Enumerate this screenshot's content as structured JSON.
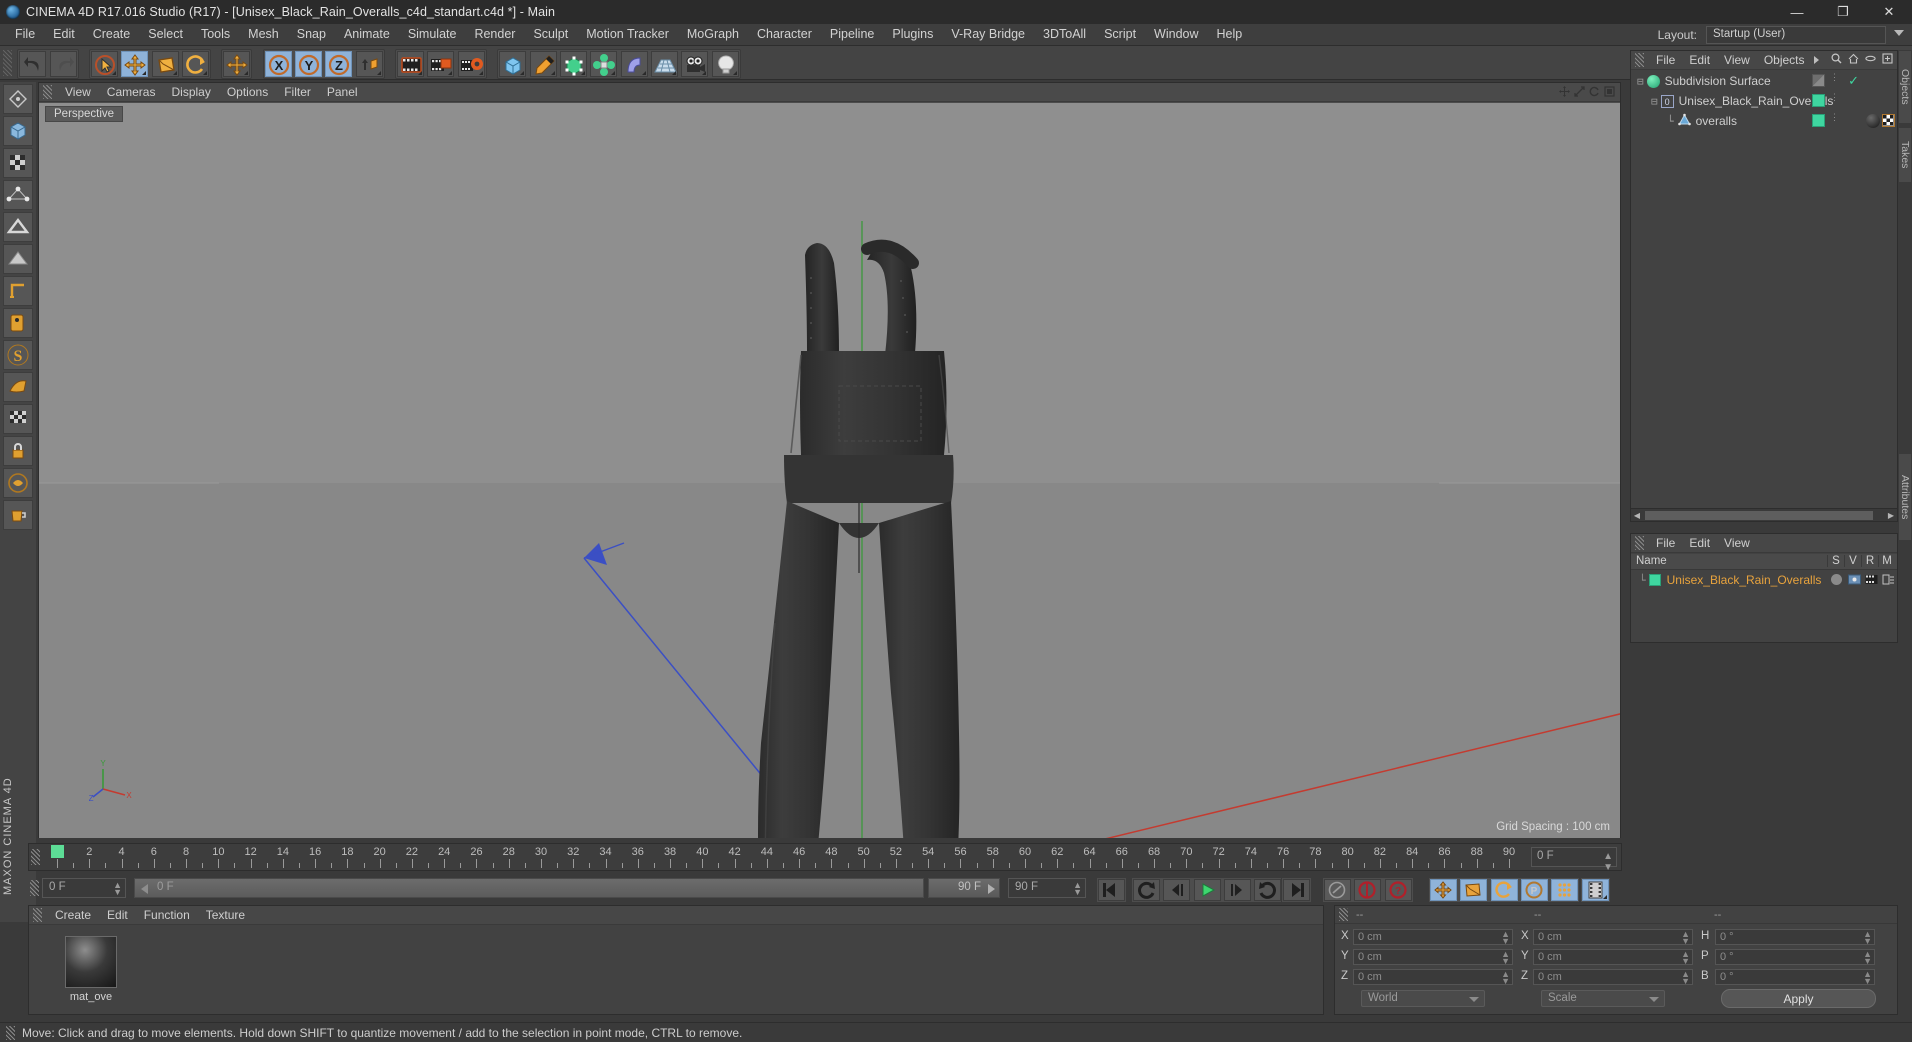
{
  "window": {
    "title": "CINEMA 4D R17.016 Studio (R17) - [Unisex_Black_Rain_Overalls_c4d_standart.c4d *] - Main",
    "app_icon": "cinema4d-logo-icon",
    "minimize": "—",
    "maximize": "❐",
    "close": "✕"
  },
  "menubar": {
    "items": [
      "File",
      "Edit",
      "Create",
      "Select",
      "Tools",
      "Mesh",
      "Snap",
      "Animate",
      "Simulate",
      "Render",
      "Sculpt",
      "Motion Tracker",
      "MoGraph",
      "Character",
      "Pipeline",
      "Plugins",
      "V-Ray Bridge",
      "3DToAll",
      "Script",
      "Window",
      "Help"
    ],
    "layout_label": "Layout:",
    "layout_value": "Startup (User)"
  },
  "toolbar": {
    "groups": [
      {
        "name": "history",
        "buttons": [
          {
            "icon": "undo-icon",
            "label": "Undo",
            "active": false
          },
          {
            "icon": "redo-icon",
            "label": "Redo",
            "active": false,
            "disabled": true
          }
        ]
      },
      {
        "name": "transform",
        "buttons": [
          {
            "icon": "live-selection-icon",
            "label": "Live Selection",
            "active": false
          },
          {
            "icon": "move-icon",
            "label": "Move",
            "active": true
          },
          {
            "icon": "scale-icon",
            "label": "Scale",
            "active": false
          },
          {
            "icon": "rotate-icon",
            "label": "Rotate",
            "active": false
          }
        ]
      },
      {
        "name": "move-world",
        "buttons": [
          {
            "icon": "move-world-icon",
            "label": "Move",
            "active": false
          }
        ]
      },
      {
        "name": "axis-locks",
        "buttons": [
          {
            "icon": "lock-x-icon",
            "label": "X",
            "active": true
          },
          {
            "icon": "lock-y-icon",
            "label": "Y",
            "active": true
          },
          {
            "icon": "lock-z-icon",
            "label": "Z",
            "active": true
          },
          {
            "icon": "world-object-icon",
            "label": "World / Object",
            "active": false
          }
        ]
      },
      {
        "name": "render",
        "buttons": [
          {
            "icon": "render-view-icon",
            "label": "Render View",
            "active": false
          },
          {
            "icon": "render-region-icon",
            "label": "Render to Picture Viewer",
            "active": false
          },
          {
            "icon": "render-settings-icon",
            "label": "Edit Render Settings",
            "active": false
          }
        ]
      },
      {
        "name": "create",
        "buttons": [
          {
            "icon": "cube-primitive-icon",
            "label": "Add Cube Object",
            "active": false
          },
          {
            "icon": "spline-pen-icon",
            "label": "Create Spline",
            "active": false
          },
          {
            "icon": "nurbs-icon",
            "label": "Subdivision Surface",
            "active": false
          },
          {
            "icon": "array-icon",
            "label": "Array Object",
            "active": false
          },
          {
            "icon": "deformer-icon",
            "label": "Bend Object",
            "active": false
          },
          {
            "icon": "floor-icon",
            "label": "Floor Object",
            "active": false
          },
          {
            "icon": "camera-icon",
            "label": "Camera",
            "active": false
          },
          {
            "icon": "light-icon",
            "label": "Light",
            "active": false
          }
        ]
      }
    ]
  },
  "left_toolbar": {
    "buttons": [
      {
        "icon": "make-editable-icon",
        "label": "Make Editable"
      },
      {
        "icon": "model-mode-icon",
        "label": "Model Mode"
      },
      {
        "icon": "texture-mode-icon",
        "label": "Texture Mode"
      },
      {
        "icon": "points-mode-icon",
        "label": "Points Mode"
      },
      {
        "icon": "edges-mode-icon",
        "label": "Edges Mode"
      },
      {
        "icon": "polygons-mode-icon",
        "label": "Polygons Mode"
      },
      {
        "icon": "axis-mode-icon",
        "label": "Enable Axis Modification"
      },
      {
        "icon": "viewport-solo-icon",
        "label": "Viewport Solo Single"
      },
      {
        "icon": "enable-snap-icon",
        "label": "Enable Snapping"
      },
      {
        "icon": "workplane-icon",
        "label": "Lock Workplane"
      },
      {
        "icon": "uv-polygons-icon",
        "label": "UV Polygons"
      },
      {
        "icon": "uv-lock-icon",
        "label": "UV Lock"
      },
      {
        "icon": "python-icon",
        "label": "Python"
      },
      {
        "icon": "coffee-icon",
        "label": "Script"
      }
    ],
    "brand": "MAXON CINEMA 4D"
  },
  "viewport": {
    "menu": [
      "View",
      "Cameras",
      "Display",
      "Options",
      "Filter",
      "Panel"
    ],
    "camera_label": "Perspective",
    "grid_spacing": "Grid Spacing : 100 cm",
    "axis_labels": {
      "x": "X",
      "y": "Y",
      "z": "Z"
    },
    "corner_icons": [
      "move-view-icon",
      "scale-view-icon",
      "rotate-view-icon",
      "maximize-view-icon"
    ],
    "object_name": "Unisex Black Rain Overalls"
  },
  "object_manager": {
    "menu": [
      "File",
      "Edit",
      "View",
      "Objects"
    ],
    "menu_overflow_icon": "chevron-right-icon",
    "header_icons": [
      "search-icon",
      "home-icon",
      "ellipse-icon",
      "new-layer-icon"
    ],
    "tab_label": "Objects",
    "tab_label_2": "Takes",
    "items": [
      {
        "name": "Subdivision Surface",
        "icon": "subdivision-surface-icon",
        "depth": 0,
        "visibility_color": "#7a7a7a",
        "checked": true
      },
      {
        "name": "Unisex_Black_Rain_Overalls",
        "icon": "null-object-icon",
        "depth": 1,
        "visibility_color": "#3fd6a0",
        "checked": false
      },
      {
        "name": "overalls",
        "icon": "polygon-object-icon",
        "depth": 2,
        "visibility_color": "#3fd6a0",
        "checked": false,
        "has_material": true
      }
    ],
    "scrollbar": {
      "left_arrow": "◀",
      "right_arrow": "▶"
    }
  },
  "material_manager_right": {
    "menu": [
      "File",
      "Edit",
      "View"
    ],
    "tab_label": "Attributes",
    "columns": [
      "Name",
      "S",
      "V",
      "R",
      "M"
    ],
    "rows": [
      {
        "name": "Unisex_Black_Rain_Overalls",
        "swatch_color": "#3fd6a0",
        "name_color": "#e8a33d"
      }
    ]
  },
  "timeline": {
    "ticks": [
      0,
      2,
      4,
      6,
      8,
      10,
      12,
      14,
      16,
      18,
      20,
      22,
      24,
      26,
      28,
      30,
      32,
      34,
      36,
      38,
      40,
      42,
      44,
      46,
      48,
      50,
      52,
      54,
      56,
      58,
      60,
      62,
      64,
      66,
      68,
      70,
      72,
      74,
      76,
      78,
      80,
      82,
      84,
      86,
      88,
      90
    ],
    "min_frame": 0,
    "max_frame": 90,
    "current_frame_display": "0 F",
    "playhead_frame": 0
  },
  "transport": {
    "current_frame_field": "0 F",
    "scrub_label": "0 F",
    "end_frame_label": "90 F",
    "preview_end_field": "90 F",
    "buttons": [
      {
        "icon": "go-to-start-icon",
        "label": "Go to Start"
      },
      {
        "icon": "prev-key-icon",
        "label": "Go to Previous Key"
      },
      {
        "icon": "prev-frame-icon",
        "label": "Go to Previous Frame"
      },
      {
        "icon": "play-icon",
        "label": "Play Forwards"
      },
      {
        "icon": "next-frame-icon",
        "label": "Go to Next Frame"
      },
      {
        "icon": "next-key-icon",
        "label": "Go to Next Key"
      },
      {
        "icon": "go-to-end-icon",
        "label": "Go to End"
      },
      {
        "icon": "record-active-objects-icon",
        "label": "Record Active Objects"
      },
      {
        "icon": "autokey-icon",
        "label": "Autokeying"
      },
      {
        "icon": "keyframe-selection-icon",
        "label": "Keyframe Selection"
      },
      {
        "icon": "position-key-icon",
        "label": "Position"
      },
      {
        "icon": "scale-key-icon",
        "label": "Scale"
      },
      {
        "icon": "rotation-key-icon",
        "label": "Rotation"
      },
      {
        "icon": "param-key-icon",
        "label": "Parameter"
      },
      {
        "icon": "pla-key-icon",
        "label": "Point Level Animation"
      },
      {
        "icon": "timeline-icon",
        "label": "Timeline"
      }
    ]
  },
  "material_manager_bottom": {
    "menu": [
      "Create",
      "Edit",
      "Function",
      "Texture"
    ],
    "materials": [
      {
        "name": "mat_ove",
        "preview": "black-sphere-preview"
      }
    ]
  },
  "coordinates": {
    "header_cols": [
      "--",
      "--",
      "--"
    ],
    "rows": [
      {
        "label_pos": "X",
        "value_pos": "0 cm",
        "label_size": "X",
        "value_size": "0 cm",
        "label_rot": "H",
        "value_rot": "0 °"
      },
      {
        "label_pos": "Y",
        "value_pos": "0 cm",
        "label_size": "Y",
        "value_size": "0 cm",
        "label_rot": "P",
        "value_rot": "0 °"
      },
      {
        "label_pos": "Z",
        "value_pos": "0 cm",
        "label_size": "Z",
        "value_size": "0 cm",
        "label_rot": "B",
        "value_rot": "0 °"
      }
    ],
    "system_dropdown": "World",
    "mode_dropdown": "Scale",
    "apply_button": "Apply"
  },
  "statusbar": {
    "message": "Move: Click and drag to move elements. Hold down SHIFT to quantize movement / add to the selection in point mode, CTRL to remove."
  },
  "colors": {
    "accent_blue": "#8fb3d9",
    "orange": "#e8a33d",
    "green": "#3fd6a0",
    "playhead_green": "#5ddd96",
    "red_axis": "#c0392b",
    "panel_bg": "#424242",
    "toolbar_bg": "#444444",
    "viewport_bg": "#8a8a8a"
  }
}
